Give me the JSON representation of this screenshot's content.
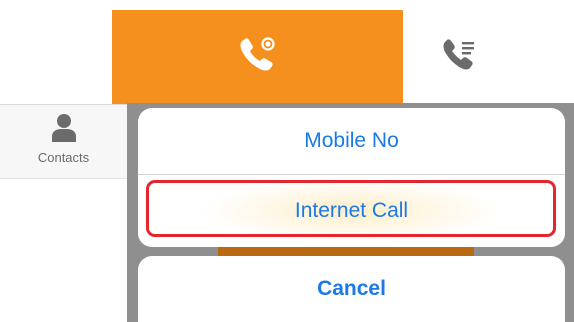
{
  "colors": {
    "accent_orange": "#f5901e",
    "link_blue": "#1b7ae6",
    "highlight_red": "#e3262f",
    "icon_gray": "#6b6b6b"
  },
  "tabs": [
    {
      "icon": "phone-ring-icon",
      "active": true
    },
    {
      "icon": "phone-list-icon",
      "active": false
    }
  ],
  "sidebar": {
    "contacts": {
      "icon": "person-icon",
      "label": "Contacts"
    }
  },
  "action_sheet": {
    "options": [
      {
        "label": "Mobile No"
      },
      {
        "label": "Internet Call",
        "highlighted": true
      }
    ],
    "cancel_label": "Cancel"
  }
}
